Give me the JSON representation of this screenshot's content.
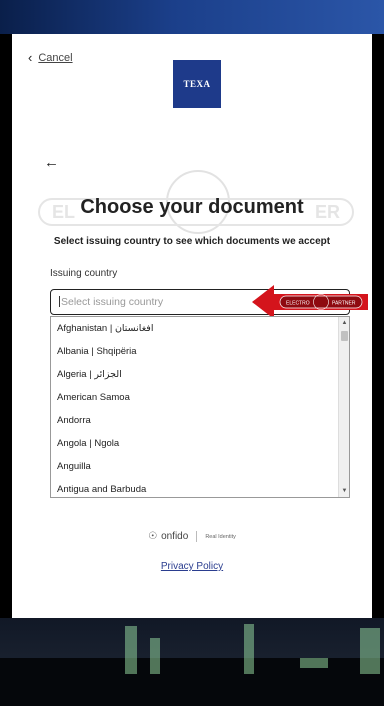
{
  "header": {
    "cancel_label": "Cancel",
    "logo_text": "TEXA"
  },
  "watermark": {
    "left_text": "EL",
    "right_text": "ER"
  },
  "main": {
    "title": "Choose your document",
    "subtitle": "Select issuing country to see which documents we accept",
    "field_label": "Issuing country",
    "input_placeholder": "Select issuing country",
    "arrow_badge": {
      "left": "ELECTRO",
      "right": "PARTNER"
    }
  },
  "countries": [
    "Afghanistan | افغانستان",
    "Albania | Shqipëria",
    "Algeria | الجزائر",
    "American Samoa",
    "Andorra",
    "Angola | Ngola",
    "Anguilla",
    "Antigua and Barbuda"
  ],
  "footer": {
    "brand_name": "onfido",
    "brand_tagline": "Real Identity",
    "privacy_label": "Privacy Policy"
  },
  "colors": {
    "accent": "#1e3a8a",
    "arrow": "#d4141c",
    "link": "#2a3d8f"
  }
}
